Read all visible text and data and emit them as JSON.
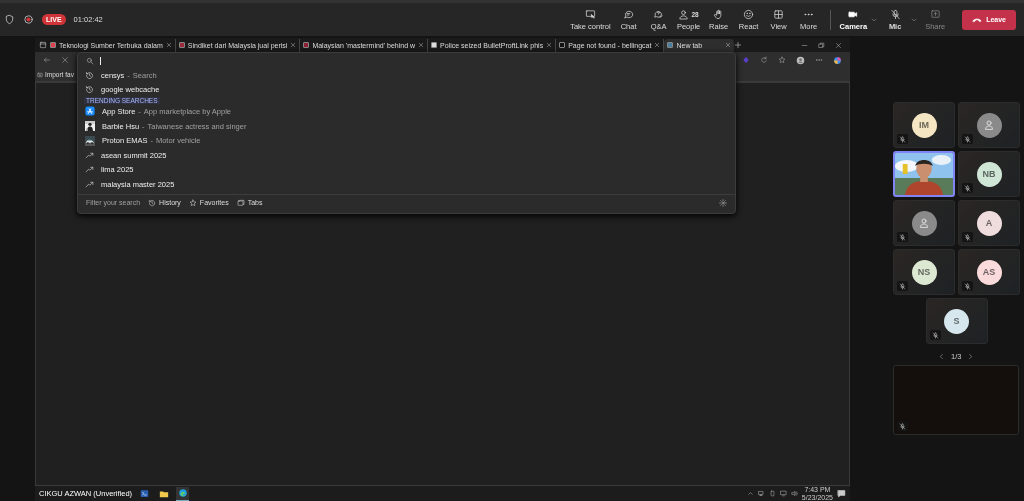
{
  "meeting_bar": {
    "live_badge": "LIVE",
    "timer": "01:02:42",
    "controls": [
      {
        "kind": "screen",
        "label": "Take control"
      },
      {
        "kind": "chat",
        "label": "Chat"
      },
      {
        "kind": "qa",
        "label": "Q&A"
      },
      {
        "kind": "people",
        "label": "People",
        "count": "28"
      },
      {
        "kind": "hand",
        "label": "Raise"
      },
      {
        "kind": "smile",
        "label": "React"
      },
      {
        "kind": "grid",
        "label": "View"
      },
      {
        "kind": "more",
        "label": "More"
      }
    ],
    "camera": {
      "label": "Camera"
    },
    "mic": {
      "label": "Mic",
      "muted": true
    },
    "share": {
      "label": "Share",
      "disabled": true
    },
    "leave": "Leave"
  },
  "browser": {
    "tabs": [
      {
        "title": "Teknologi Sumber Terbuka dalam",
        "selected": false
      },
      {
        "title": "Sindiket dari Malaysia jual perisi",
        "selected": false
      },
      {
        "title": "Malaysian 'mastermind' behind w",
        "selected": false
      },
      {
        "title": "Police seized BulletProftLink phis",
        "selected": false
      },
      {
        "title": "Page not found - bellingcat",
        "selected": false
      },
      {
        "title": "New tab",
        "selected": true
      }
    ],
    "bookmarks_bar": "Import fav",
    "suggestions": [
      {
        "kind": "history",
        "text": "censys",
        "separator": "-",
        "detail": "Search"
      },
      {
        "kind": "history",
        "text": "google webcache"
      }
    ],
    "trending_heading": "TRENDING SEARCHES",
    "trending": [
      {
        "kind": "app",
        "text": "App Store",
        "separator": "-",
        "detail": "App marketplace by Apple"
      },
      {
        "kind": "person",
        "text": "Barbie Hsu",
        "separator": "-",
        "detail": "Taiwanese actress and singer"
      },
      {
        "kind": "car",
        "text": "Proton EMAS",
        "separator": "-",
        "detail": "Motor vehicle"
      },
      {
        "kind": "trend",
        "text": "asean summit 2025"
      },
      {
        "kind": "trend",
        "text": "lima 2025"
      },
      {
        "kind": "trend",
        "text": "malaysia master 2025"
      }
    ],
    "filter": {
      "label": "Filter your search",
      "options": [
        "History",
        "Favorites",
        "Tabs"
      ]
    }
  },
  "taskbar": {
    "presenter": "CIKGU AZWAN (Unverified)",
    "time": "7:43 PM",
    "date": "5/23/2025"
  },
  "participants": [
    {
      "kind": "initials",
      "initials": "IM",
      "color": "#f4e5c3",
      "muted": true
    },
    {
      "kind": "avatar",
      "muted": true
    },
    {
      "kind": "video",
      "muted": false,
      "selected": true
    },
    {
      "kind": "initials",
      "initials": "NB",
      "color": "#cfe5d6",
      "muted": true
    },
    {
      "kind": "avatar",
      "muted": true
    },
    {
      "kind": "initials",
      "initials": "A",
      "color": "#efdcdc",
      "muted": true
    },
    {
      "kind": "initials",
      "initials": "NS",
      "color": "#dde8d2",
      "muted": true
    },
    {
      "kind": "initials",
      "initials": "AS",
      "color": "#fadada",
      "muted": true
    },
    {
      "kind": "initials",
      "initials": "S",
      "color": "#d6e7ee",
      "muted": true
    }
  ],
  "pager": "1/3",
  "spotlight": {
    "kind": "blank",
    "muted": true
  }
}
